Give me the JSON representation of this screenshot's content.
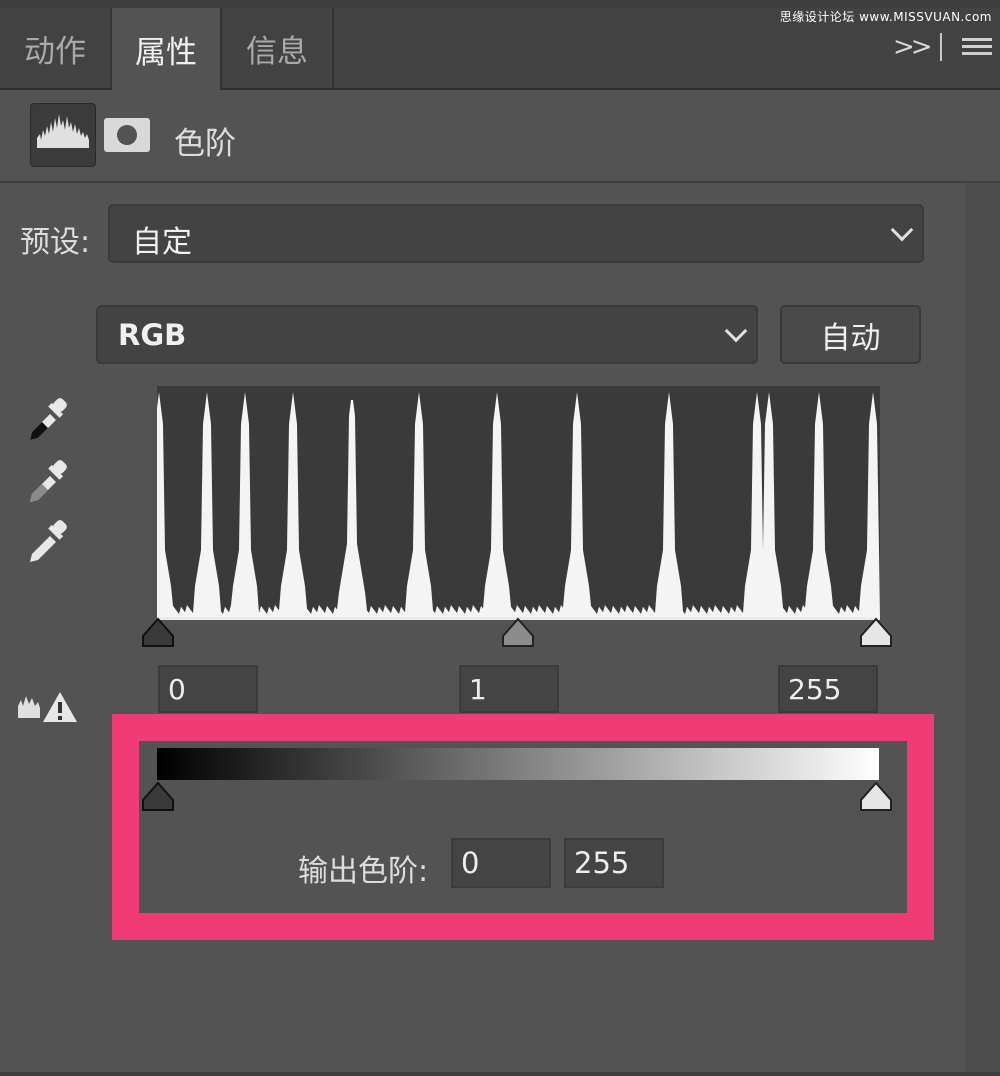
{
  "watermark": "思缘设计论坛 www.MISSVUAN.com",
  "tabs": [
    {
      "label": "动作",
      "active": false
    },
    {
      "label": "属性",
      "active": true
    },
    {
      "label": "信息",
      "active": false
    }
  ],
  "panel": {
    "name": "色阶",
    "icons": [
      "histogram-icon",
      "mask-icon"
    ]
  },
  "preset": {
    "label": "预设:",
    "value": "自定"
  },
  "channel": {
    "value": "RGB"
  },
  "auto_button": "自动",
  "eyedroppers": [
    "black-point-eyedropper-icon",
    "gray-point-eyedropper-icon",
    "white-point-eyedropper-icon"
  ],
  "input_levels": {
    "shadow": "0",
    "midtone": "1",
    "highlight": "255"
  },
  "output_levels": {
    "label": "输出色阶:",
    "shadow": "0",
    "highlight": "255"
  },
  "colors": {
    "highlight_frame": "#f03b76",
    "panel_bg": "#535353"
  }
}
